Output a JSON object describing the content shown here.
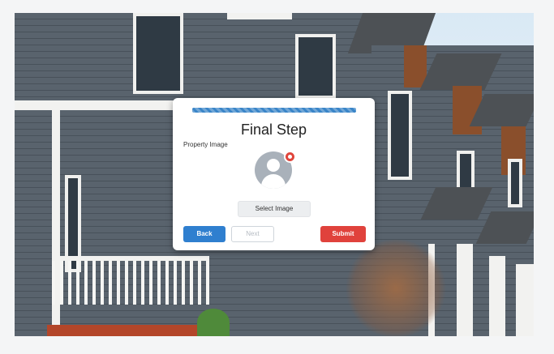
{
  "modal": {
    "progress_percent": 100,
    "title": "Final Step",
    "field_label": "Property Image",
    "avatar_icon": "user-avatar-icon",
    "remove_icon": "remove-image-icon",
    "select_image_label": "Select Image",
    "back_label": "Back",
    "next_label": "Next",
    "submit_label": "Submit"
  },
  "colors": {
    "primary": "#2f7fcf",
    "danger": "#e0423c",
    "progress": "#3a85c8"
  }
}
